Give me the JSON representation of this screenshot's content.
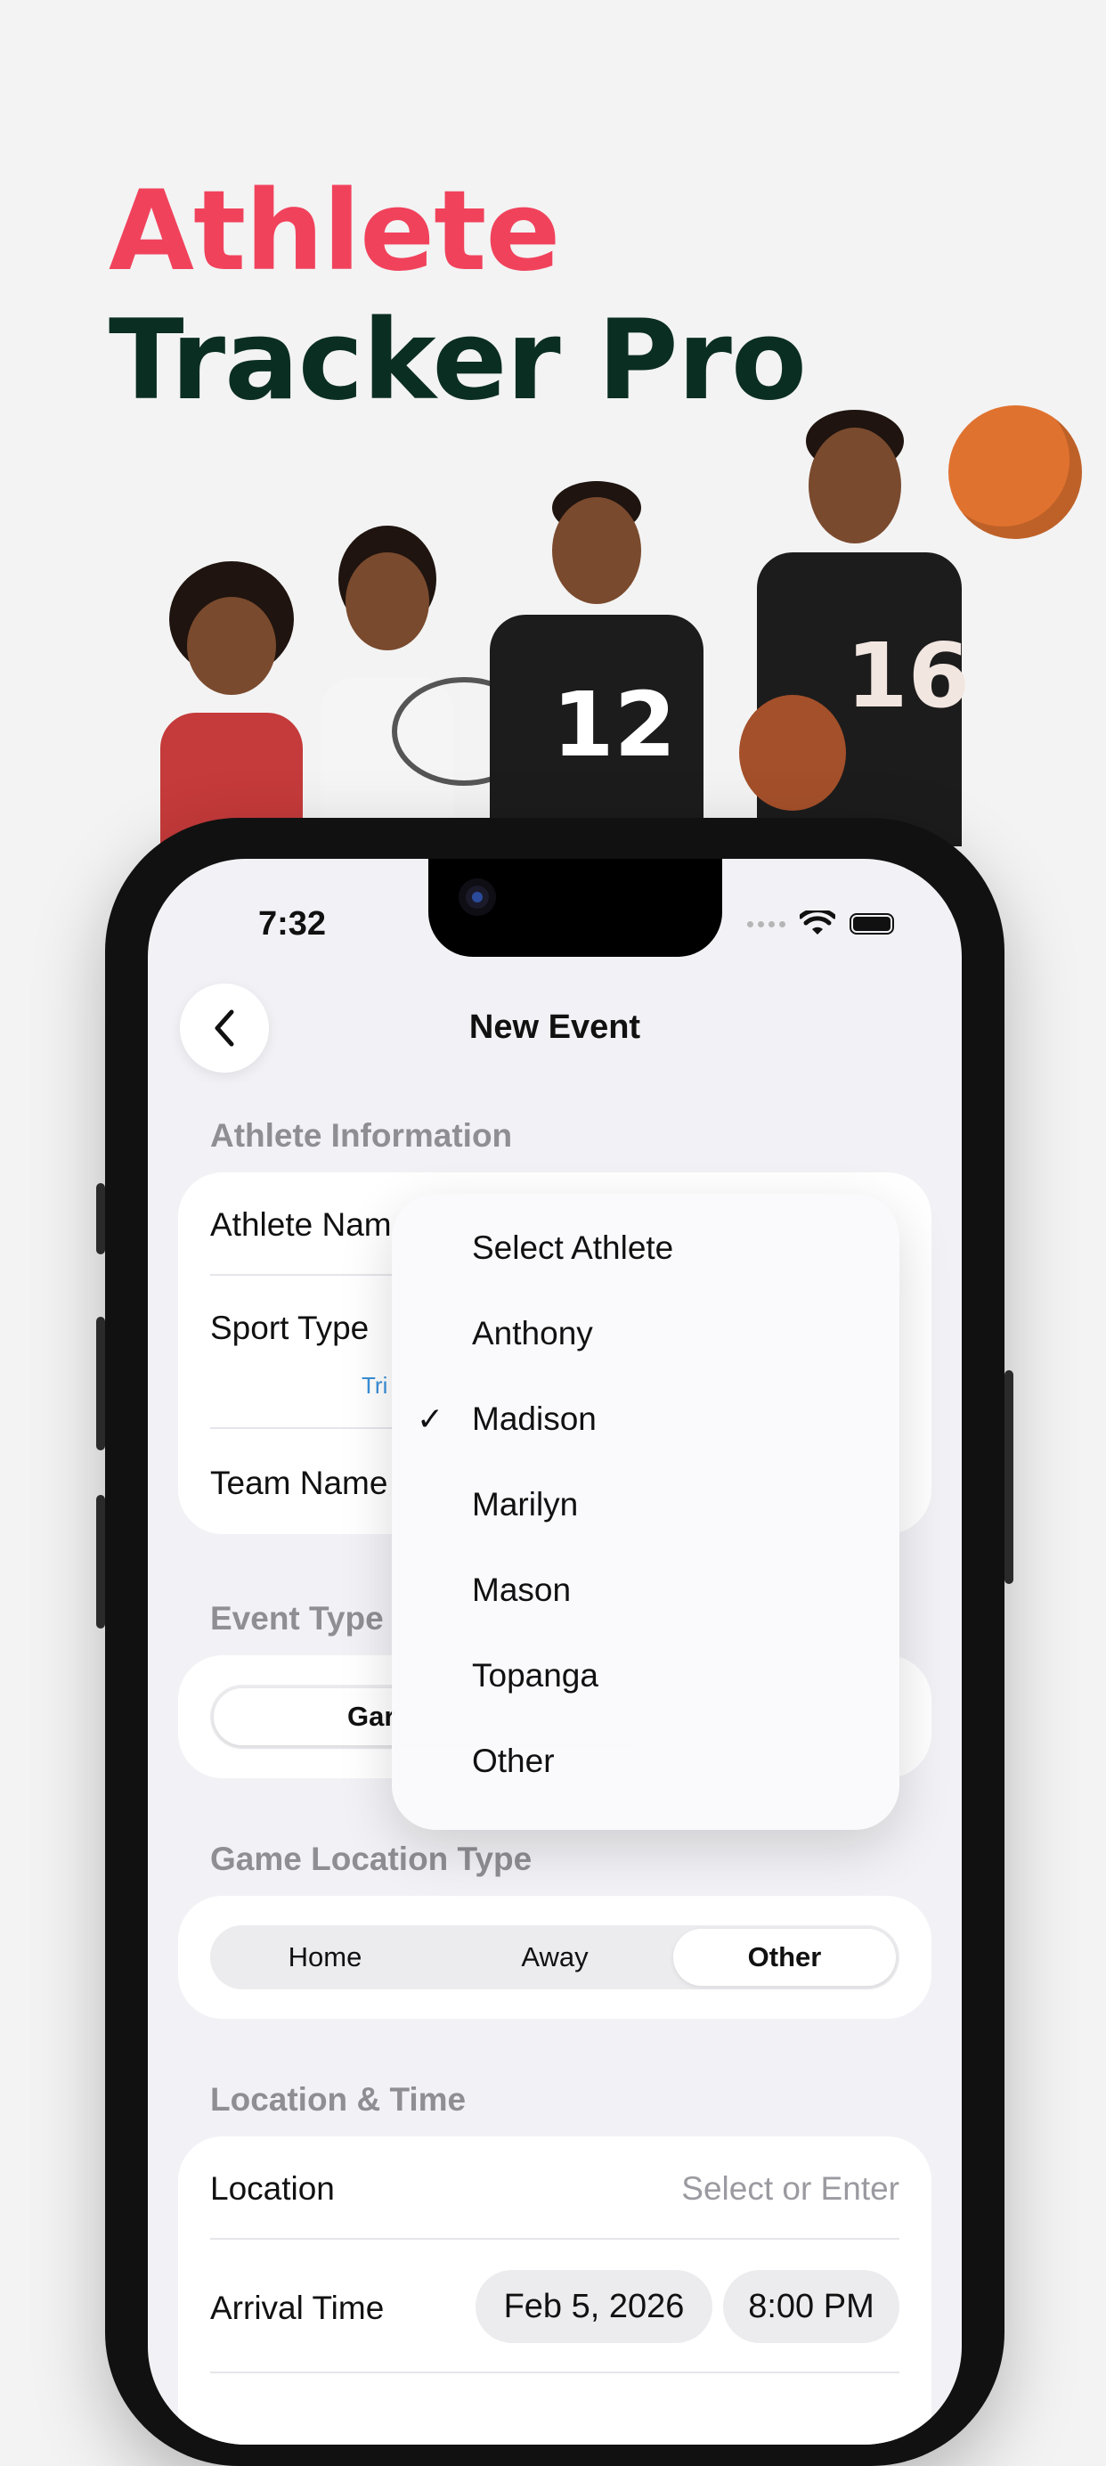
{
  "headline": {
    "line1": "Athlete",
    "line2": "Tracker Pro"
  },
  "colors": {
    "headline_accent": "#f1425c",
    "headline_dark": "#0b2e22"
  },
  "athletes": {
    "jersey_numbers": [
      "12",
      "16"
    ]
  },
  "status_bar": {
    "time": "7:32"
  },
  "nav": {
    "title": "New Event",
    "back_icon": "chevron-left-icon"
  },
  "athlete_info": {
    "section_title": "Athlete Information",
    "athlete_name_label": "Athlete Nam",
    "sport_type_label": "Sport Type",
    "sport_sub_text": "Tri",
    "team_name_label": "Team Name"
  },
  "event_type": {
    "section_title": "Event Type",
    "selected_partial": "Gar"
  },
  "game_location": {
    "section_title": "Game Location Type",
    "options": [
      "Home",
      "Away",
      "Other"
    ],
    "selected": "Other"
  },
  "location_time": {
    "section_title": "Location & Time",
    "location_label": "Location",
    "location_placeholder": "Select or Enter",
    "arrival_label": "Arrival Time",
    "arrival_date": "Feb 5, 2026",
    "arrival_time": "8:00 PM"
  },
  "athlete_dropdown": {
    "items": [
      "Select Athlete",
      "Anthony",
      "Madison",
      "Marilyn",
      "Mason",
      "Topanga",
      "Other"
    ],
    "selected": "Madison",
    "check_glyph": "✓"
  }
}
